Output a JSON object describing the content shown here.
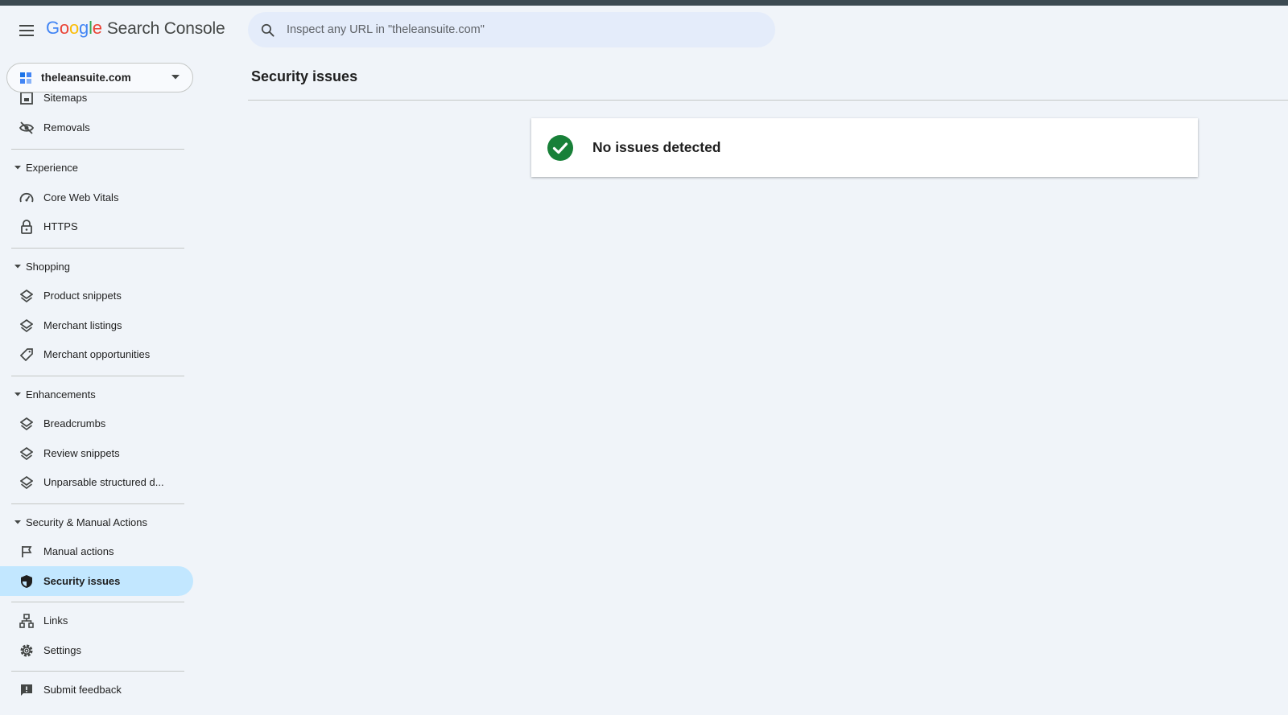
{
  "header": {
    "logo_google": [
      "G",
      "o",
      "o",
      "g",
      "l",
      "e"
    ],
    "logo_product": "Search Console",
    "search_placeholder": "Inspect any URL in \"theleansuite.com\""
  },
  "property": {
    "label": "theleansuite.com"
  },
  "sidebar": {
    "items": [
      {
        "label": "Sitemaps",
        "icon": "sitemap-icon"
      },
      {
        "label": "Removals",
        "icon": "eye-off-icon"
      },
      {
        "section": "Experience"
      },
      {
        "label": "Core Web Vitals",
        "icon": "speedometer-icon"
      },
      {
        "label": "HTTPS",
        "icon": "lock-icon"
      },
      {
        "section": "Shopping"
      },
      {
        "label": "Product snippets",
        "icon": "layers-icon"
      },
      {
        "label": "Merchant listings",
        "icon": "layers-icon"
      },
      {
        "label": "Merchant opportunities",
        "icon": "tag-icon"
      },
      {
        "section": "Enhancements"
      },
      {
        "label": "Breadcrumbs",
        "icon": "layers-icon"
      },
      {
        "label": "Review snippets",
        "icon": "layers-icon"
      },
      {
        "label": "Unparsable structured d...",
        "icon": "layers-icon"
      },
      {
        "section": "Security & Manual Actions"
      },
      {
        "label": "Manual actions",
        "icon": "flag-icon"
      },
      {
        "label": "Security issues",
        "icon": "shield-icon",
        "active": true
      },
      {
        "label": "Links",
        "icon": "links-icon"
      },
      {
        "label": "Settings",
        "icon": "gear-icon"
      },
      {
        "label": "Submit feedback",
        "icon": "feedback-icon"
      }
    ]
  },
  "main": {
    "page_title": "Security issues",
    "status_message": "No issues detected",
    "status_icon": "check-circle-icon"
  },
  "colors": {
    "accent_active": "#c2e7ff",
    "success": "#188038",
    "background": "#f0f4f9",
    "search_bg": "#e4ecfa"
  }
}
